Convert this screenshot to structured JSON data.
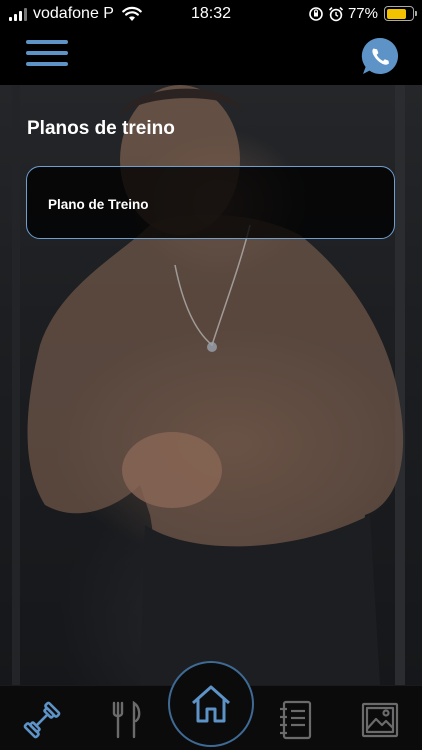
{
  "status_bar": {
    "carrier": "vodafone P",
    "time": "18:32",
    "battery_percent": "77%",
    "battery_level": 0.77,
    "battery_color": "#f2c200"
  },
  "header": {
    "menu_icon": "hamburger-menu-icon",
    "contact_icon": "whatsapp-icon",
    "accent_color": "#5d93c6"
  },
  "main": {
    "title": "Planos de treino",
    "plans": [
      {
        "label": "Plano de Treino"
      }
    ]
  },
  "bottom_nav": {
    "items": [
      {
        "icon": "dumbbell-icon",
        "active": true
      },
      {
        "icon": "fork-knife-icon",
        "active": false
      },
      {
        "icon": "home-icon",
        "active": false
      },
      {
        "icon": "notebook-icon",
        "active": false
      },
      {
        "icon": "gallery-icon",
        "active": false
      }
    ],
    "active_color": "#5d93c6",
    "inactive_color": "#6b6b6b"
  }
}
